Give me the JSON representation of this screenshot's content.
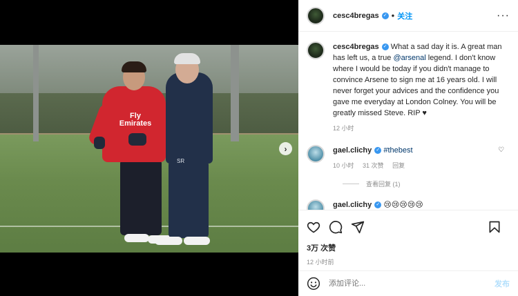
{
  "post": {
    "author": "cesc4bregas",
    "follow_label": "关注",
    "more_label": "···",
    "next_label": "›"
  },
  "caption": {
    "author": "cesc4bregas",
    "text_before": " What a sad day it is. A great man has left us, a true ",
    "mention": "@arsenal",
    "text_after": " legend. I don't know where I would be today if you didn't manage to convince Arsene to sign me at 16 years old. I will never forget your advices and the confidence you gave me everyday at London Colney. You will be greatly missed Steve. RIP ",
    "heart": "♥",
    "time": "12 小时"
  },
  "comments": [
    {
      "author": "gael.clichy",
      "mention": "#thebest",
      "time": "10 小时",
      "likes": "31 次赞",
      "reply_label": "回复",
      "view_replies": "查看回复 (1)"
    },
    {
      "author": "gael.clichy",
      "text": "😢😢😢😢😢"
    }
  ],
  "photo": {
    "jersey_text": "Fly Emirates",
    "coach_initials": "SR"
  },
  "footer": {
    "likes": "3万 次赞",
    "time": "12 小时前",
    "comment_placeholder": "添加评论...",
    "post_label": "发布"
  },
  "colors": {
    "accent": "#0095f6",
    "verified": "#3897f0",
    "mention": "#00376b",
    "muted": "#8e8e8e"
  },
  "icons": [
    "heart-icon",
    "comment-icon",
    "share-icon",
    "bookmark-icon",
    "emoji-icon",
    "verified-icon",
    "next-arrow-icon",
    "more-icon"
  ]
}
